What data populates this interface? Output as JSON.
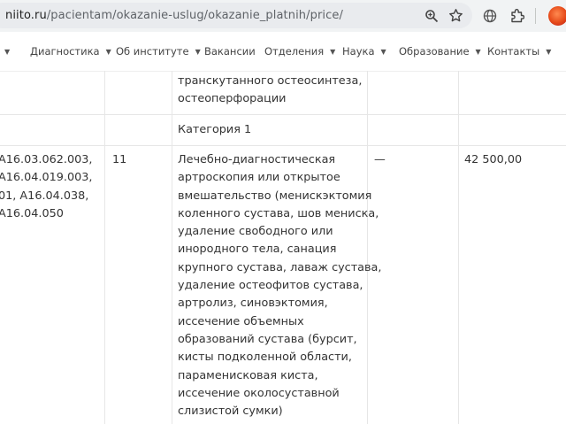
{
  "browser": {
    "url_host": "niito.ru",
    "url_path": "/pacientam/okazanie-uslug/okazanie_platnih/price/"
  },
  "nav": {
    "items": [
      {
        "label": ""
      },
      {
        "label": "Диагностика"
      },
      {
        "label": "Об институте"
      },
      {
        "label": "Вакансии"
      },
      {
        "label": "Отделения"
      },
      {
        "label": "Наука"
      },
      {
        "label": "Образование"
      },
      {
        "label": "Контакты"
      }
    ]
  },
  "table": {
    "top_row": {
      "service_lines": [
        "транскутанного остеосинтеза,",
        "остеоперфорации"
      ]
    },
    "category_row": {
      "label": "Категория 1"
    },
    "service_row": {
      "codes": [
        "A16.03.062.003,",
        "A16.04.019.003,",
        "01, A16.04.038,",
        "A16.04.050"
      ],
      "number": "11",
      "description": [
        "Лечебно-диагностическая",
        "артроскопия или открытое",
        "вмешательство (менискэктомия",
        "коленного сустава, шов мениска,",
        "удаление свободного или",
        "инородного тела, санация",
        "крупного сустава, лаваж сустава,",
        "удаление остеофитов сустава,",
        "артролиз, синовэктомия,",
        "иссечение объемных",
        "образований сустава (бурсит,",
        "кисты подколенной области,",
        "параменисковая киста,",
        "иссечение околосуставной",
        "слизистой сумки)"
      ],
      "dash": "—",
      "price": "42 500,00"
    }
  }
}
